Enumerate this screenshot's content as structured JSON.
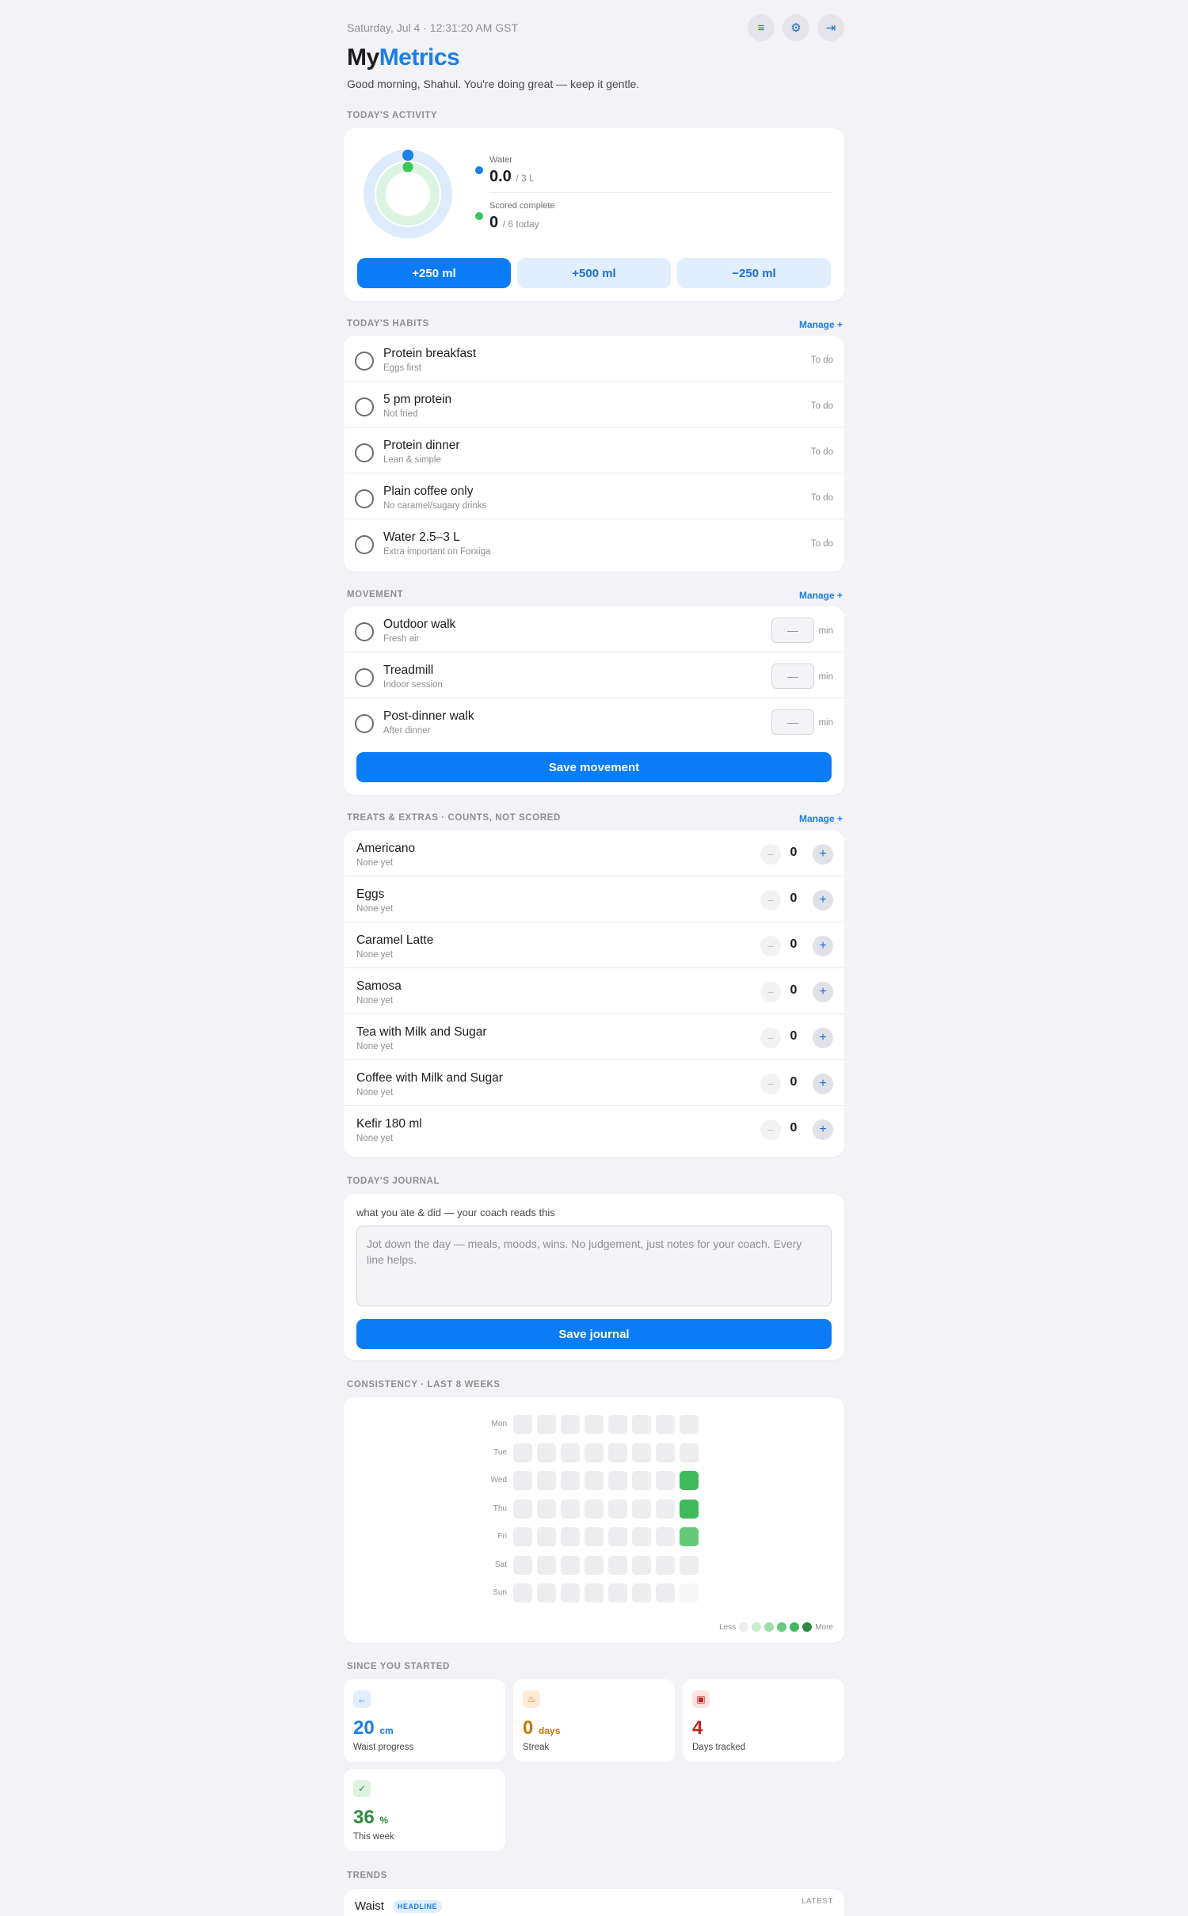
{
  "header": {
    "datetime": "Saturday, Jul 4 · 12:31:20 AM GST",
    "brand_part1": "My",
    "brand_part2": "Metrics",
    "greeting": "Good morning, Shahul. You're doing great — keep it gentle.",
    "icons": [
      "menu-icon",
      "gear-icon",
      "logout-icon"
    ]
  },
  "activity": {
    "section_label": "Today's Activity",
    "water_label": "Water",
    "water_value": "0.0",
    "water_unit": "/ 3 L",
    "score_label": "Scored complete",
    "score_value": "0",
    "score_unit": "/ 6 today",
    "buttons": [
      "+250 ml",
      "+500 ml",
      "−250 ml"
    ],
    "water_color": "#1a7fe6",
    "score_color": "#34c759"
  },
  "habits": {
    "section_label": "Today's Habits",
    "manage_label": "Manage +",
    "items": [
      {
        "title": "Protein breakfast",
        "subtitle": "Eggs first",
        "status": "To do"
      },
      {
        "title": "5 pm protein",
        "subtitle": "Not fried",
        "status": "To do"
      },
      {
        "title": "Protein dinner",
        "subtitle": "Lean & simple",
        "status": "To do"
      },
      {
        "title": "Plain coffee only",
        "subtitle": "No caramel/sugary drinks",
        "status": "To do"
      },
      {
        "title": "Water 2.5–3 L",
        "subtitle": "Extra important on Forxiga",
        "status": "To do"
      }
    ]
  },
  "movement": {
    "section_label": "Movement",
    "manage_label": "Manage +",
    "items": [
      {
        "title": "Outdoor walk",
        "subtitle": "Fresh air",
        "placeholder": "—",
        "unit": "min"
      },
      {
        "title": "Treadmill",
        "subtitle": "Indoor session",
        "placeholder": "—",
        "unit": "min"
      },
      {
        "title": "Post-dinner walk",
        "subtitle": "After dinner",
        "placeholder": "—",
        "unit": "min"
      }
    ],
    "save_label": "Save movement"
  },
  "treats": {
    "section_label": "Treats & Extras · Counts, not scored",
    "manage_label": "Manage +",
    "items": [
      {
        "title": "Americano",
        "subtitle": "None yet",
        "count": "0"
      },
      {
        "title": "Eggs",
        "subtitle": "None yet",
        "count": "0"
      },
      {
        "title": "Caramel Latte",
        "subtitle": "None yet",
        "count": "0"
      },
      {
        "title": "Samosa",
        "subtitle": "None yet",
        "count": "0"
      },
      {
        "title": "Tea with Milk and Sugar",
        "subtitle": "None yet",
        "count": "0"
      },
      {
        "title": "Coffee with Milk and Sugar",
        "subtitle": "None yet",
        "count": "0"
      },
      {
        "title": "Kefir 180 ml",
        "subtitle": "None yet",
        "count": "0"
      }
    ],
    "minus_glyph": "−",
    "plus_glyph": "+"
  },
  "journal": {
    "section_label": "Today's Journal",
    "hint": "what you ate & did — your coach reads this",
    "placeholder": "Jot down the day — meals, moods, wins. No judgement, just notes for your coach. Every line helps.",
    "save_label": "Save journal"
  },
  "consistency": {
    "section_label": "Consistency · Last 8 weeks",
    "days": [
      "Mon",
      "Tue",
      "Wed",
      "Thu",
      "Fri",
      "Sat",
      "Sun"
    ],
    "weeks": 8,
    "levels": [
      [
        0,
        0,
        0,
        0,
        0,
        0,
        0,
        0
      ],
      [
        0,
        0,
        0,
        0,
        0,
        0,
        0,
        0
      ],
      [
        0,
        0,
        0,
        0,
        0,
        0,
        0,
        4
      ],
      [
        0,
        0,
        0,
        0,
        0,
        0,
        0,
        4
      ],
      [
        0,
        0,
        0,
        0,
        0,
        0,
        0,
        3
      ],
      [
        0,
        0,
        0,
        0,
        0,
        0,
        0,
        0
      ],
      [
        0,
        0,
        0,
        0,
        0,
        0,
        0,
        -1
      ]
    ],
    "legend_less": "Less",
    "legend_more": "More",
    "level_colors": [
      "#ededf0",
      "#c8ecd0",
      "#9edcaa",
      "#66c97a",
      "#3fb95a",
      "#2a8c3f"
    ],
    "future_color": "#f7f7f9"
  },
  "since": {
    "section_label": "Since you started",
    "stats": [
      {
        "icon": "arrow-left-icon",
        "glyph": "←",
        "value": "20",
        "unit": "cm",
        "label": "Waist progress",
        "color": "#1a7fe6",
        "bg": "#e1eefd"
      },
      {
        "icon": "flame-icon",
        "glyph": "♨",
        "value": "0",
        "unit": "days",
        "label": "Streak",
        "color": "#c77700",
        "bg": "#fdebd8"
      },
      {
        "icon": "calendar-icon",
        "glyph": "▣",
        "value": "4",
        "unit": "",
        "label": "Days tracked",
        "color": "#c4221a",
        "bg": "#fde2e1"
      },
      {
        "icon": "check-icon",
        "glyph": "✓",
        "value": "36",
        "unit": "%",
        "label": "This week",
        "color": "#2e8b3e",
        "bg": "#ddf3e1"
      }
    ]
  },
  "trends": {
    "section_label": "Trends",
    "title": "Waist",
    "badge": "HEADLINE",
    "latest_label": "LATEST"
  }
}
